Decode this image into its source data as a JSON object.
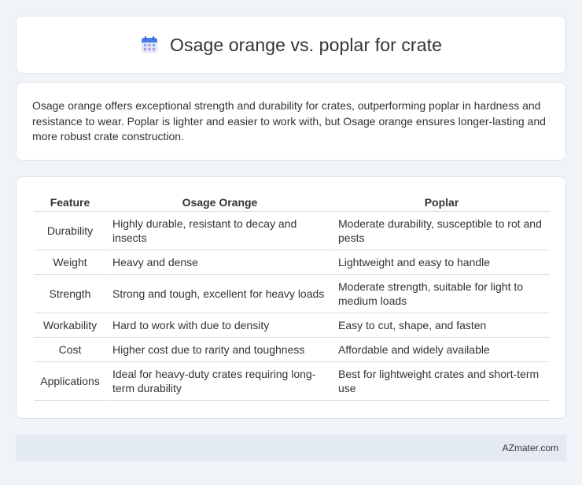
{
  "header": {
    "title": "Osage orange vs. poplar for crate",
    "icon": "calendar-icon",
    "accent": "#4a7de8"
  },
  "summary": {
    "text": "Osage orange offers exceptional strength and durability for crates, outperforming poplar in hardness and resistance to wear. Poplar is lighter and easier to work with, but Osage orange ensures longer-lasting and more robust crate construction."
  },
  "table": {
    "headers": [
      "Feature",
      "Osage Orange",
      "Poplar"
    ],
    "rows": [
      {
        "feature": "Durability",
        "osage": "Highly durable, resistant to decay and insects",
        "poplar": "Moderate durability, susceptible to rot and pests"
      },
      {
        "feature": "Weight",
        "osage": "Heavy and dense",
        "poplar": "Lightweight and easy to handle"
      },
      {
        "feature": "Strength",
        "osage": "Strong and tough, excellent for heavy loads",
        "poplar": "Moderate strength, suitable for light to medium loads"
      },
      {
        "feature": "Workability",
        "osage": "Hard to work with due to density",
        "poplar": "Easy to cut, shape, and fasten"
      },
      {
        "feature": "Cost",
        "osage": "Higher cost due to rarity and toughness",
        "poplar": "Affordable and widely available"
      },
      {
        "feature": "Applications",
        "osage": "Ideal for heavy-duty crates requiring long-term durability",
        "poplar": "Best for lightweight crates and short-term use"
      }
    ]
  },
  "footer": {
    "brand": "AZmater.com"
  }
}
